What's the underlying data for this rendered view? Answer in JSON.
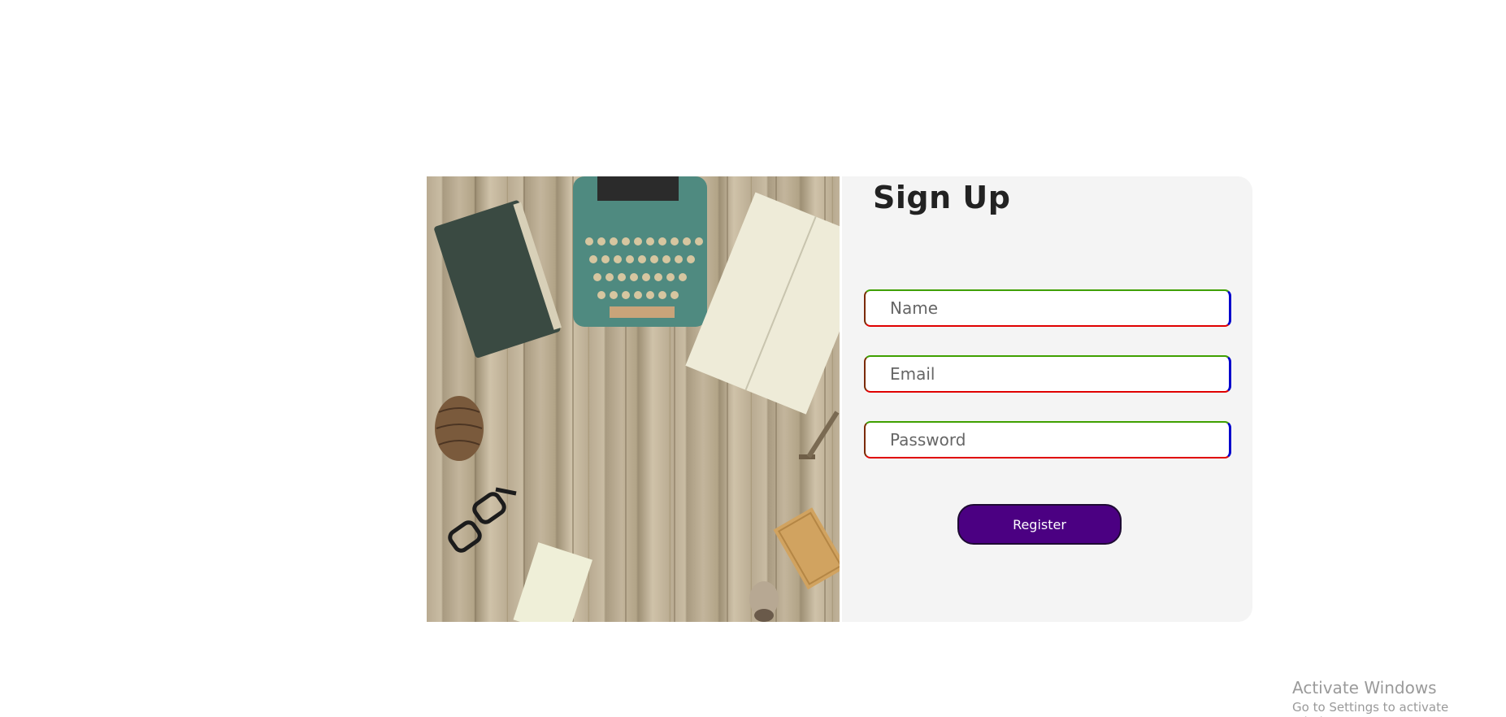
{
  "signup": {
    "title": "Sign Up",
    "fields": {
      "name_placeholder": "Name",
      "email_placeholder": "Email",
      "password_placeholder": "Password"
    },
    "register_label": "Register"
  },
  "colors": {
    "card_background": "#f4f4f4",
    "button_background": "#4b0082",
    "border_top": "#3fa000",
    "border_bottom": "#e00000",
    "border_right": "#0000cc"
  },
  "watermark": {
    "title": "Activate Windows",
    "subtitle": "Go to Settings to activate Windows."
  },
  "image": {
    "description_icon": "desk-photo-icon"
  }
}
